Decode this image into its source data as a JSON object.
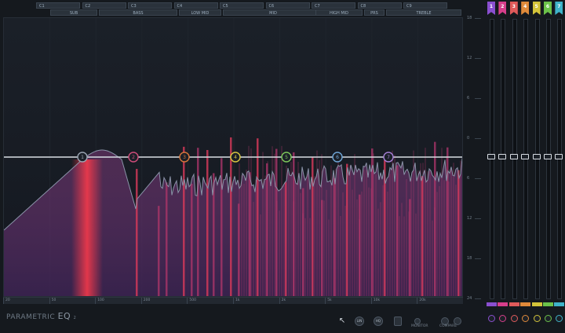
{
  "bands": [
    "C1",
    "C2",
    "C3",
    "C4",
    "C5",
    "C6",
    "C7",
    "C8",
    "C9"
  ],
  "regions": [
    "SUB",
    "BASS",
    "LOW MID",
    "MID",
    "HIGH MID",
    "PRS",
    "TREBLE"
  ],
  "freq_labels": [
    "20",
    "50",
    "100",
    "200",
    "500",
    "1k",
    "2k",
    "5k",
    "10k",
    "20k"
  ],
  "db_labels": [
    "18",
    "12",
    "6",
    "0",
    "6",
    "12",
    "18",
    "24"
  ],
  "node_numbers": [
    "1",
    "2",
    "3",
    "4",
    "5",
    "6",
    "7"
  ],
  "node_colors": [
    "#9aa4b2",
    "#d04c7a",
    "#d8753a",
    "#d8c640",
    "#7fc85a",
    "#6fa6d8",
    "#a57fd6"
  ],
  "channels": [
    {
      "flag": "1",
      "color": "#8a4fd0"
    },
    {
      "flag": "2",
      "color": "#d63e8b"
    },
    {
      "flag": "3",
      "color": "#e05a5a"
    },
    {
      "flag": "4",
      "color": "#e08a3a"
    },
    {
      "flag": "5",
      "color": "#d4c43a"
    },
    {
      "flag": "6",
      "color": "#6cc24a"
    },
    {
      "flag": "7",
      "color": "#3fb3c9"
    }
  ],
  "product": {
    "name": "PARAMETRIC",
    "suffix": "EQ",
    "number": "2"
  },
  "bottom": {
    "lin_label": "LIN",
    "hq_label": "HQ",
    "monitor_label": "MONITOR",
    "compare_label": "COMPARE"
  }
}
